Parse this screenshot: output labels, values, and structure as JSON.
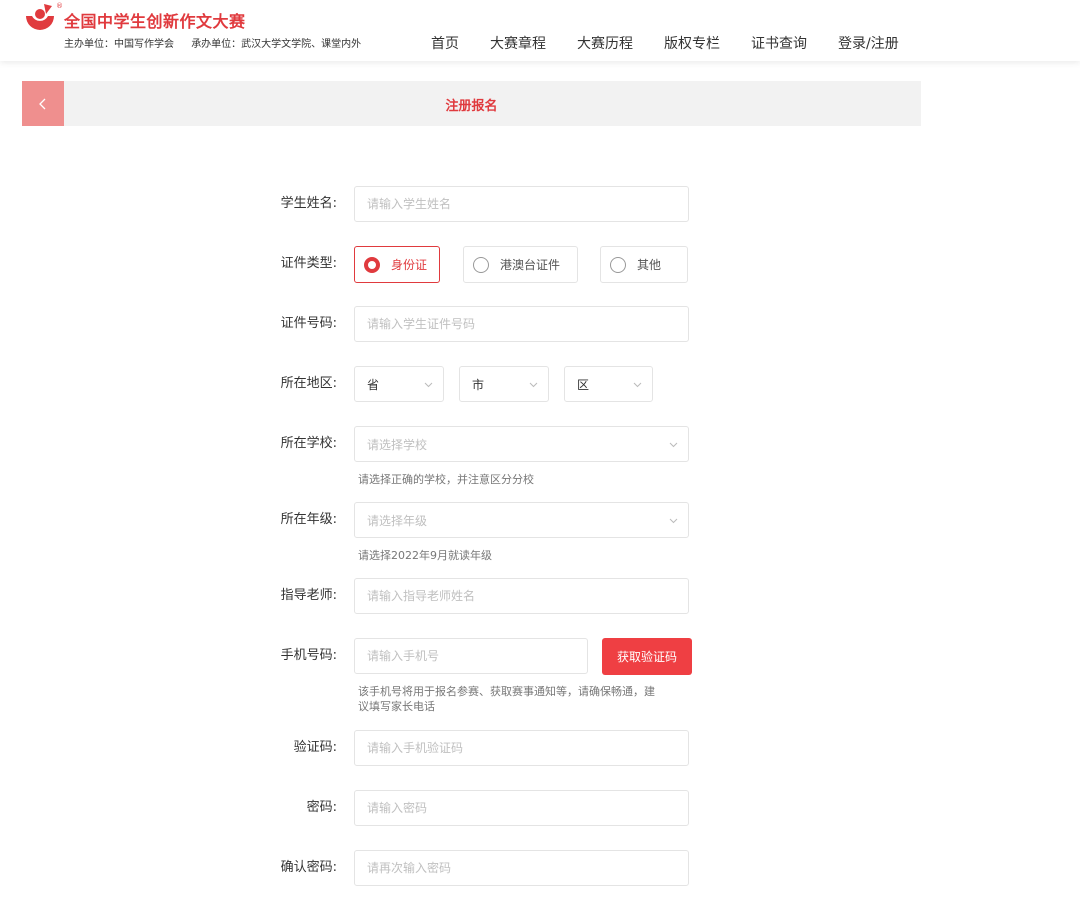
{
  "header": {
    "title": "全国中学生创新作文大赛",
    "logo_mark": "®",
    "organizer": "主办单位：中国写作学会",
    "co_organizer": "承办单位：武汉大学文学院、课堂内外",
    "nav": [
      "首页",
      "大赛章程",
      "大赛历程",
      "版权专栏",
      "证书查询",
      "登录/注册"
    ]
  },
  "title_bar": {
    "title": "注册报名"
  },
  "form": {
    "student_name": {
      "label": "学生姓名:",
      "placeholder": "请输入学生姓名"
    },
    "id_type": {
      "label": "证件类型:",
      "options": [
        "身份证",
        "港澳台证件",
        "其他"
      ],
      "selected": "身份证"
    },
    "id_number": {
      "label": "证件号码:",
      "placeholder": "请输入学生证件号码"
    },
    "region": {
      "label": "所在地区:",
      "province": "省",
      "city": "市",
      "district": "区"
    },
    "school": {
      "label": "所在学校:",
      "placeholder": "请选择学校",
      "hint": "请选择正确的学校，并注意区分分校"
    },
    "grade": {
      "label": "所在年级:",
      "placeholder": "请选择年级",
      "hint": "请选择2022年9月就读年级"
    },
    "teacher": {
      "label": "指导老师:",
      "placeholder": "请输入指导老师姓名"
    },
    "phone": {
      "label": "手机号码:",
      "placeholder": "请输入手机号",
      "button": "获取验证码",
      "hint_line1": "该手机号将用于报名参赛、获取赛事通知等，请确保畅通，建",
      "hint_line2": "议填写家长电话"
    },
    "code": {
      "label": "验证码:",
      "placeholder": "请输入手机验证码"
    },
    "password": {
      "label": "密码:",
      "placeholder": "请输入密码"
    },
    "confirm_password": {
      "label": "确认密码:",
      "placeholder": "请再次输入密码"
    }
  },
  "colors": {
    "brand_red": "#e03a3e",
    "button_red": "#ef3f43",
    "back_button": "#ef8f8e",
    "title_bar_bg": "#f2f2f2"
  },
  "icons": {
    "logo": "contest-logo-icon",
    "back": "chevron-left-icon",
    "dropdown": "chevron-down-icon"
  }
}
